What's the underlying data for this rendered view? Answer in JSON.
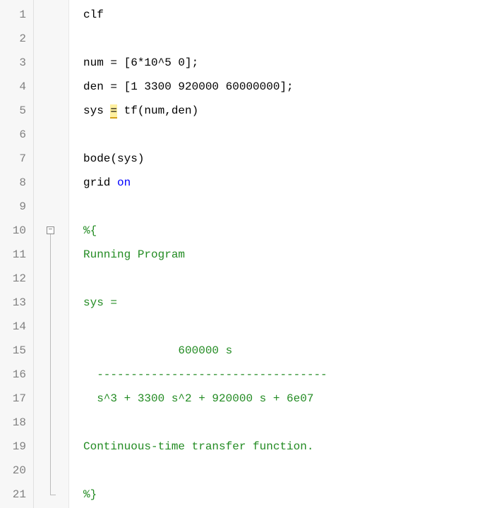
{
  "lineCount": 21,
  "foldStart": 10,
  "foldEnd": 21,
  "foldSymbol": "−",
  "lines": {
    "1": [
      {
        "t": "clf",
        "c": ""
      }
    ],
    "2": [],
    "3": [
      {
        "t": "num = [6*10^5 0];",
        "c": ""
      }
    ],
    "4": [
      {
        "t": "den = [1 3300 920000 60000000];",
        "c": ""
      }
    ],
    "5": [
      {
        "t": "sys ",
        "c": ""
      },
      {
        "t": "=",
        "c": "warning-underline"
      },
      {
        "t": " tf(num,den)",
        "c": ""
      }
    ],
    "6": [],
    "7": [
      {
        "t": "bode(sys)",
        "c": ""
      }
    ],
    "8": [
      {
        "t": "grid ",
        "c": ""
      },
      {
        "t": "on",
        "c": "keyword"
      }
    ],
    "9": [],
    "10": [
      {
        "t": "%{",
        "c": "comment"
      }
    ],
    "11": [
      {
        "t": "Running Program",
        "c": "comment"
      }
    ],
    "12": [],
    "13": [
      {
        "t": "sys =",
        "c": "comment"
      }
    ],
    "14": [],
    "15": [
      {
        "t": "              600000 s",
        "c": "comment"
      }
    ],
    "16": [
      {
        "t": "  ----------------------------------",
        "c": "comment"
      }
    ],
    "17": [
      {
        "t": "  s^3 + 3300 s^2 + 920000 s + 6e07",
        "c": "comment"
      }
    ],
    "18": [],
    "19": [
      {
        "t": "Continuous-time transfer function.",
        "c": "comment"
      }
    ],
    "20": [],
    "21": [
      {
        "t": "%}",
        "c": "comment"
      }
    ]
  }
}
